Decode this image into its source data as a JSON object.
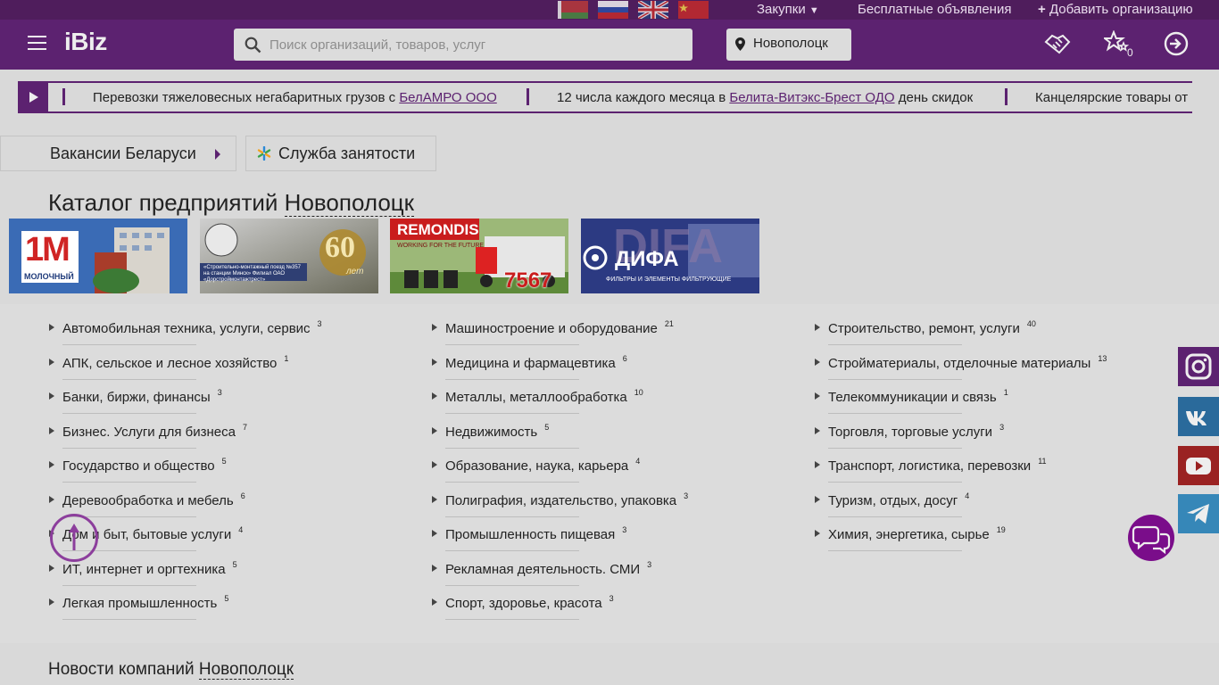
{
  "topbar": {
    "flags": [
      "flag-belarus-icon",
      "flag-russia-icon",
      "flag-uk-icon",
      "flag-china-icon"
    ],
    "purchases": "Закупки",
    "free_ads": "Бесплатные объявления",
    "add_org": "Добавить организацию"
  },
  "header": {
    "logo": "iBiz",
    "search_placeholder": "Поиск организаций, товаров, услуг",
    "city": "Новополоцк",
    "favorites_count": "0"
  },
  "ticker": {
    "items": [
      {
        "pre": "Перевозки тяжеловесных негабаритных грузов с ",
        "link": "БелАМРО ООО",
        "post": ""
      },
      {
        "pre": "12 числа каждого месяца в ",
        "link": "Белита-Витэкс-Брест ОДО",
        "post": " день скидок"
      },
      {
        "pre": "Канцелярские товары от",
        "link": "",
        "post": ""
      }
    ]
  },
  "quick_buttons": {
    "vacancies": "Вакансии Беларуси",
    "employment": "Служба занятости"
  },
  "catalog": {
    "title_prefix": "Каталог предприятий",
    "title_city": "Новополоцк",
    "banners": [
      {
        "name": "banner-molochny",
        "text_main": "1M",
        "text_sub": "МОЛОЧНЫЙ"
      },
      {
        "name": "banner-smp357",
        "text_main": "60",
        "text_sub": "«Строительно-монтажный поезд №357 на станции Минск» Филиал ОАО «Дорстроймонтажтрест»",
        "text_years": "лет"
      },
      {
        "name": "banner-remondis",
        "text_main": "REMONDIS",
        "text_sub": "WORKING FOR THE FUTURE",
        "text_num": "7567"
      },
      {
        "name": "banner-difa",
        "text_main": "ДИФА",
        "text_sub": "ФИЛЬТРЫ И ЭЛЕМЕНТЫ ФИЛЬТРУЮЩИЕ",
        "text_bg": "DIFA"
      }
    ],
    "columns": [
      [
        {
          "label": "Автомобильная техника, услуги, сервис",
          "count": "3"
        },
        {
          "label": "АПК, сельское и лесное хозяйство",
          "count": "1"
        },
        {
          "label": "Банки, биржи, финансы",
          "count": "3"
        },
        {
          "label": "Бизнес. Услуги для бизнеса",
          "count": "7"
        },
        {
          "label": "Государство и общество",
          "count": "5"
        },
        {
          "label": "Деревообработка и мебель",
          "count": "6"
        },
        {
          "label": "Дом и быт, бытовые услуги",
          "count": "4"
        },
        {
          "label": "ИТ, интернет и оргтехника",
          "count": "5"
        },
        {
          "label": "Легкая промышленность",
          "count": "5"
        }
      ],
      [
        {
          "label": "Машиностроение и оборудование",
          "count": "21"
        },
        {
          "label": "Медицина и фармацевтика",
          "count": "6"
        },
        {
          "label": "Металлы, металлообработка",
          "count": "10"
        },
        {
          "label": "Недвижимость",
          "count": "5"
        },
        {
          "label": "Образование, наука, карьера",
          "count": "4"
        },
        {
          "label": "Полиграфия, издательство, упаковка",
          "count": "3"
        },
        {
          "label": "Промышленность пищевая",
          "count": "3"
        },
        {
          "label": "Рекламная деятельность. СМИ",
          "count": "3"
        },
        {
          "label": "Спорт, здоровье, красота",
          "count": "3"
        }
      ],
      [
        {
          "label": "Строительство, ремонт, услуги",
          "count": "40"
        },
        {
          "label": "Стройматериалы, отделочные материалы",
          "count": "13"
        },
        {
          "label": "Телекоммуникации и связь",
          "count": "1"
        },
        {
          "label": "Торговля, торговые услуги",
          "count": "3"
        },
        {
          "label": "Транспорт, логистика, перевозки",
          "count": "11"
        },
        {
          "label": "Туризм, отдых, досуг",
          "count": "4"
        },
        {
          "label": "Химия, энергетика, сырье",
          "count": "19"
        }
      ]
    ]
  },
  "news": {
    "title_prefix": "Новости компаний",
    "title_city": "Новополоцк"
  },
  "social": [
    "instagram-icon",
    "vk-icon",
    "youtube-icon",
    "telegram-icon"
  ],
  "colors": {
    "brand": "#5c2270",
    "topbar": "#4f1d5c",
    "page_bg": "#d9d9d9"
  }
}
